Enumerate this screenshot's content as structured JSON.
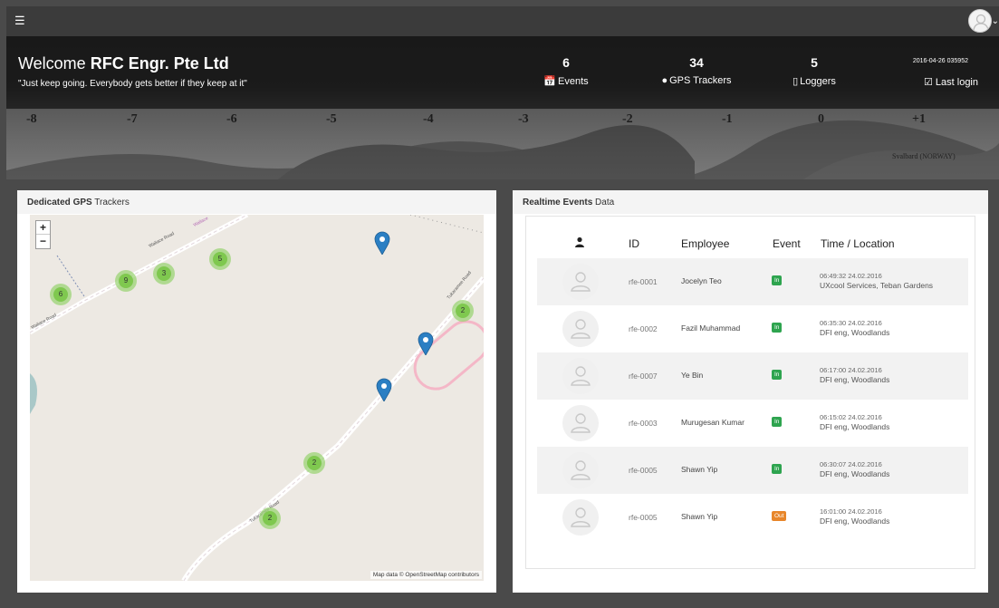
{
  "topbar": {
    "menu_icon": "hamburger-icon",
    "avatar_icon": "user-avatar-icon"
  },
  "hero": {
    "welcome_prefix": "Welcome ",
    "company": "RFC Engr. Pte Ltd",
    "quote": "\"Just keep going. Everybody gets better if they keep at it\"",
    "stats": [
      {
        "value": "6",
        "label": "Events",
        "icon": "calendar-icon"
      },
      {
        "value": "34",
        "label": "GPS Trackers",
        "icon": "map-marker-icon"
      },
      {
        "value": "5",
        "label": "Loggers",
        "icon": "tablet-icon"
      }
    ],
    "timestamp": "2016-04-26 035952",
    "last_login_label": "Last login",
    "scale_labels": [
      "-8",
      "-7",
      "-6",
      "-5",
      "-4",
      "-3",
      "-2",
      "-1",
      "0",
      "+1"
    ],
    "map_text": "Svalbard (NORWAY)"
  },
  "left_panel": {
    "title_bold": "Dedicated GPS",
    "title_rest": " Trackers",
    "zoom_in": "+",
    "zoom_out": "−",
    "clusters": [
      "6",
      "9",
      "3",
      "5",
      "2",
      "2",
      "2"
    ],
    "road_labels": [
      "Wallace Road",
      "Wallace Road",
      "Tukaramee Road",
      "Tukaramee Road",
      "Wallace"
    ],
    "attribution": "Map data © OpenStreetMap contributors"
  },
  "right_panel": {
    "title_bold": "Realtime Events",
    "title_rest": " Data",
    "columns": {
      "photo_icon": "user-icon",
      "id": "ID",
      "employee": "Employee",
      "event": "Event",
      "time_location": "Time / Location"
    },
    "rows": [
      {
        "id": "rfe-0001",
        "employee": "Jocelyn Teo",
        "event": "In",
        "time": "06:49:32 24.02.2016",
        "location": "UXcool Services, Teban Gardens"
      },
      {
        "id": "rfe-0002",
        "employee": "Fazil Muhammad",
        "event": "In",
        "time": "06:35:30 24.02.2016",
        "location": "DFI eng, Woodlands"
      },
      {
        "id": "rfe-0007",
        "employee": "Ye Bin",
        "event": "In",
        "time": "06:17:00 24.02.2016",
        "location": "DFI eng, Woodlands"
      },
      {
        "id": "rfe-0003",
        "employee": "Murugesan Kumar",
        "event": "In",
        "time": "06:15:02 24.02.2016",
        "location": "DFI eng, Woodlands"
      },
      {
        "id": "rfe-0005",
        "employee": "Shawn Yip",
        "event": "In",
        "time": "06:30:07 24.02.2016",
        "location": "DFI eng, Woodlands"
      },
      {
        "id": "rfe-0005",
        "employee": "Shawn Yip",
        "event": "Out",
        "time": "16:01:00 24.02.2016",
        "location": "DFI eng, Woodlands"
      }
    ]
  },
  "colors": {
    "in_badge": "#2ea44f",
    "out_badge": "#e8862a",
    "cluster": "#7fc84f",
    "pin": "#2b7fc3"
  }
}
